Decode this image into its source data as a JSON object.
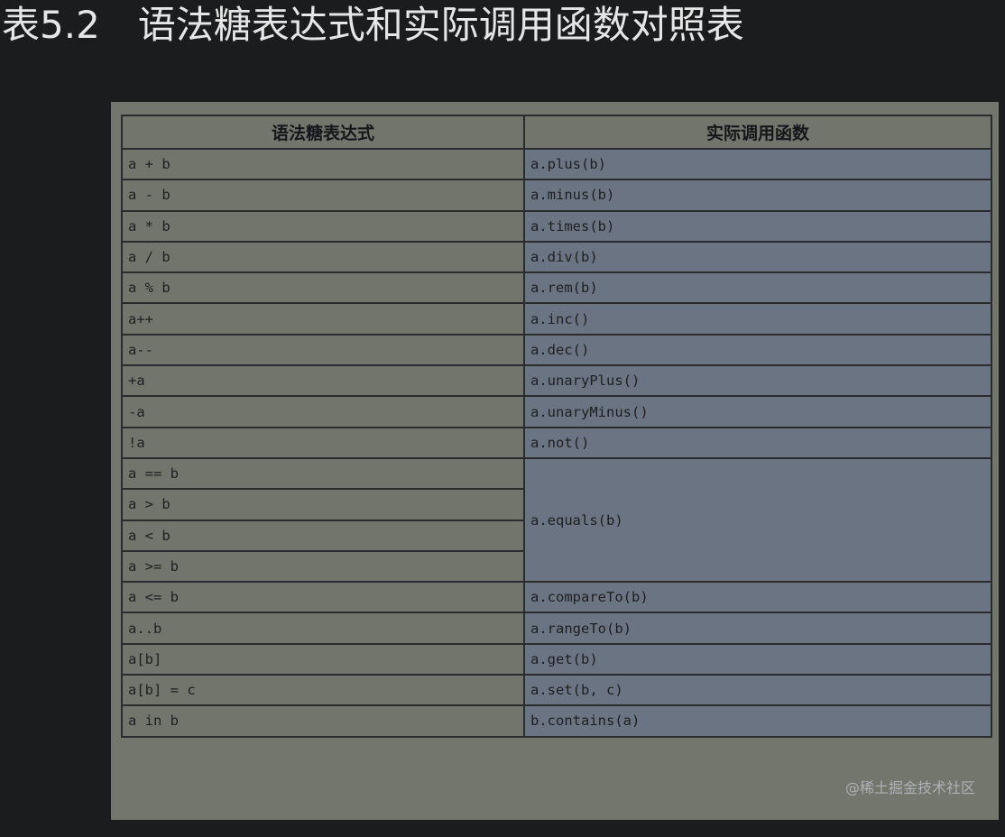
{
  "caption": {
    "number": "表5.2",
    "title": "语法糖表达式和实际调用函数对照表"
  },
  "table": {
    "headers": [
      "语法糖表达式",
      "实际调用函数"
    ],
    "rows": [
      {
        "expr": "a + b",
        "func": "a.plus(b)"
      },
      {
        "expr": "a - b",
        "func": "a.minus(b)"
      },
      {
        "expr": "a * b",
        "func": "a.times(b)"
      },
      {
        "expr": "a / b",
        "func": "a.div(b)"
      },
      {
        "expr": "a % b",
        "func": "a.rem(b)"
      },
      {
        "expr": "a++",
        "func": "a.inc()"
      },
      {
        "expr": "a--",
        "func": "a.dec()"
      },
      {
        "expr": "+a",
        "func": "a.unaryPlus()"
      },
      {
        "expr": "-a",
        "func": "a.unaryMinus()"
      },
      {
        "expr": "!a",
        "func": "a.not()"
      },
      {
        "expr": "a == b",
        "func": "a.equals(b)"
      },
      {
        "expr": "a > b"
      },
      {
        "expr": "a < b"
      },
      {
        "expr": "a >= b"
      },
      {
        "expr": "a <= b",
        "func": "a.compareTo(b)"
      },
      {
        "expr": "a..b",
        "func": "a.rangeTo(b)"
      },
      {
        "expr": "a[b]",
        "func": "a.get(b)"
      },
      {
        "expr": "a[b] = c",
        "func": "a.set(b, c)"
      },
      {
        "expr": "a in b",
        "func": "b.contains(a)"
      }
    ]
  },
  "watermark": "@稀土掘金技术社区",
  "colors": {
    "page_background": "#1b1c1e",
    "caption_text": "#e6e6e6",
    "left_cell": "#72756c",
    "right_cell": "#6b7483",
    "border": "#2a2b2c"
  }
}
